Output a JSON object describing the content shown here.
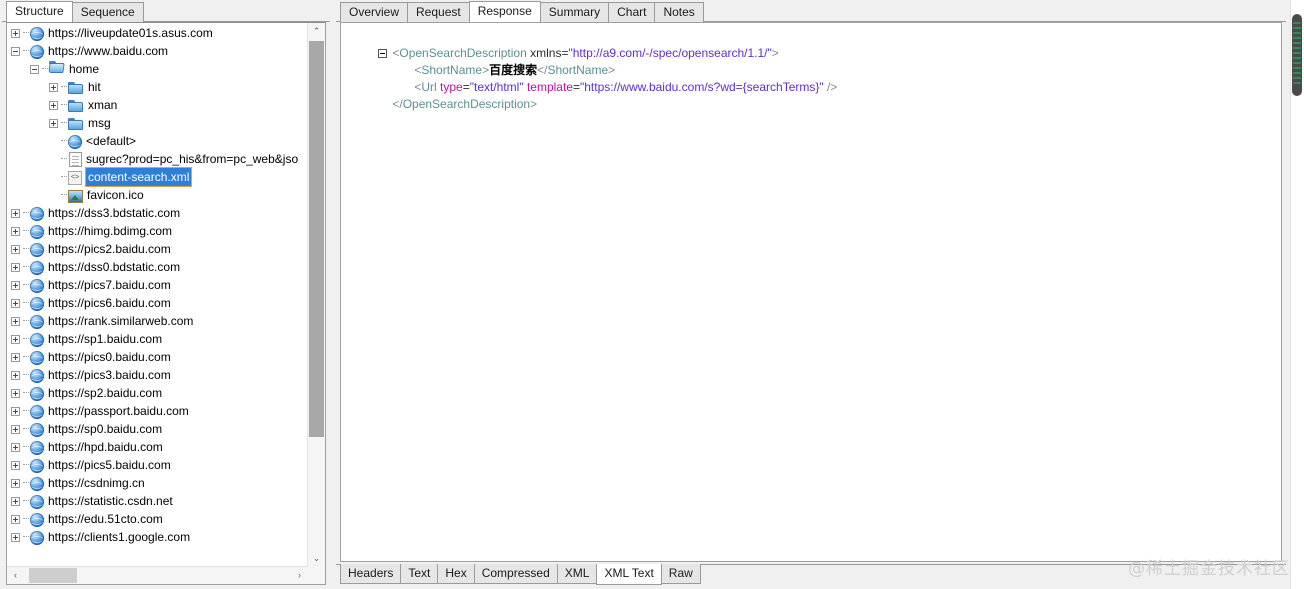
{
  "left_panel": {
    "tabs": [
      {
        "label": "Structure",
        "active": true
      },
      {
        "label": "Sequence",
        "active": false
      }
    ],
    "tree": [
      {
        "depth": 0,
        "expander": "plus",
        "icon": "globe-icon",
        "label": "https://liveupdate01s.asus.com",
        "selected": false
      },
      {
        "depth": 0,
        "expander": "minus",
        "icon": "globe-icon",
        "label": "https://www.baidu.com",
        "selected": false
      },
      {
        "depth": 1,
        "expander": "minus",
        "icon": "folder-open-icon",
        "label": "home",
        "selected": false
      },
      {
        "depth": 2,
        "expander": "plus",
        "icon": "folder-icon",
        "label": "hit",
        "selected": false
      },
      {
        "depth": 2,
        "expander": "plus",
        "icon": "folder-icon",
        "label": "xman",
        "selected": false
      },
      {
        "depth": 2,
        "expander": "plus",
        "icon": "folder-icon",
        "label": "msg",
        "selected": false
      },
      {
        "depth": 2,
        "expander": "none",
        "icon": "globe-icon",
        "label": "<default>",
        "selected": false
      },
      {
        "depth": 2,
        "expander": "none",
        "icon": "document-icon",
        "label": "sugrec?prod=pc_his&from=pc_web&jso",
        "selected": false
      },
      {
        "depth": 2,
        "expander": "none",
        "icon": "xml-file-icon",
        "label": "content-search.xml",
        "selected": true
      },
      {
        "depth": 2,
        "expander": "none",
        "icon": "image-file-icon",
        "label": "favicon.ico",
        "selected": false
      },
      {
        "depth": 0,
        "expander": "plus",
        "icon": "globe-icon",
        "label": "https://dss3.bdstatic.com",
        "selected": false
      },
      {
        "depth": 0,
        "expander": "plus",
        "icon": "globe-icon",
        "label": "https://himg.bdimg.com",
        "selected": false
      },
      {
        "depth": 0,
        "expander": "plus",
        "icon": "globe-icon",
        "label": "https://pics2.baidu.com",
        "selected": false
      },
      {
        "depth": 0,
        "expander": "plus",
        "icon": "globe-icon",
        "label": "https://dss0.bdstatic.com",
        "selected": false
      },
      {
        "depth": 0,
        "expander": "plus",
        "icon": "globe-icon",
        "label": "https://pics7.baidu.com",
        "selected": false
      },
      {
        "depth": 0,
        "expander": "plus",
        "icon": "globe-icon",
        "label": "https://pics6.baidu.com",
        "selected": false
      },
      {
        "depth": 0,
        "expander": "plus",
        "icon": "globe-icon",
        "label": "https://rank.similarweb.com",
        "selected": false
      },
      {
        "depth": 0,
        "expander": "plus",
        "icon": "globe-icon",
        "label": "https://sp1.baidu.com",
        "selected": false
      },
      {
        "depth": 0,
        "expander": "plus",
        "icon": "globe-icon",
        "label": "https://pics0.baidu.com",
        "selected": false
      },
      {
        "depth": 0,
        "expander": "plus",
        "icon": "globe-icon",
        "label": "https://pics3.baidu.com",
        "selected": false
      },
      {
        "depth": 0,
        "expander": "plus",
        "icon": "globe-icon",
        "label": "https://sp2.baidu.com",
        "selected": false
      },
      {
        "depth": 0,
        "expander": "plus",
        "icon": "globe-icon",
        "label": "https://passport.baidu.com",
        "selected": false
      },
      {
        "depth": 0,
        "expander": "plus",
        "icon": "globe-icon",
        "label": "https://sp0.baidu.com",
        "selected": false
      },
      {
        "depth": 0,
        "expander": "plus",
        "icon": "globe-icon",
        "label": "https://hpd.baidu.com",
        "selected": false
      },
      {
        "depth": 0,
        "expander": "plus",
        "icon": "globe-icon",
        "label": "https://pics5.baidu.com",
        "selected": false
      },
      {
        "depth": 0,
        "expander": "plus",
        "icon": "globe-icon",
        "label": "https://csdnimg.cn",
        "selected": false
      },
      {
        "depth": 0,
        "expander": "plus",
        "icon": "globe-icon",
        "label": "https://statistic.csdn.net",
        "selected": false
      },
      {
        "depth": 0,
        "expander": "plus",
        "icon": "globe-icon",
        "label": "https://edu.51cto.com",
        "selected": false
      },
      {
        "depth": 0,
        "expander": "plus",
        "icon": "globe-icon",
        "label": "https://clients1.google.com",
        "selected": false
      }
    ],
    "scrollbar": {
      "up_arrow": "⌃",
      "down_arrow": "⌄",
      "left_arrow": "‹",
      "right_arrow": "›"
    }
  },
  "right_panel": {
    "top_tabs": [
      {
        "label": "Overview",
        "active": false
      },
      {
        "label": "Request",
        "active": false
      },
      {
        "label": "Response",
        "active": true
      },
      {
        "label": "Summary",
        "active": false
      },
      {
        "label": "Chart",
        "active": false
      },
      {
        "label": "Notes",
        "active": false
      }
    ],
    "bottom_tabs": [
      {
        "label": "Headers",
        "active": false
      },
      {
        "label": "Text",
        "active": false
      },
      {
        "label": "Hex",
        "active": false
      },
      {
        "label": "Compressed",
        "active": false
      },
      {
        "label": "XML",
        "active": false
      },
      {
        "label": "XML Text",
        "active": true
      },
      {
        "label": "Raw",
        "active": false
      }
    ],
    "xml": {
      "line1": {
        "open_bracket": "<",
        "tag": "OpenSearchDescription",
        "space": " ",
        "attr_name": "xmlns",
        "equals": "=",
        "attr_value": "\"http://a9.com/-/spec/opensearch/1.1/\"",
        "close_bracket": ">"
      },
      "line2": {
        "open_bracket": "<",
        "tag": "ShortName",
        "close_bracket": ">",
        "text": "百度搜索",
        "end_open": "</",
        "end_tag": "ShortName",
        "end_close": ">"
      },
      "line3": {
        "open_bracket": "<",
        "tag": "Url",
        "space1": " ",
        "attr1_name": "type",
        "equals1": "=",
        "attr1_value": "\"text/html\"",
        "space2": " ",
        "attr2_name": "template",
        "equals2": "=",
        "attr2_value": "\"https://www.baidu.com/s?wd={searchTerms}\"",
        "close_bracket": " />"
      },
      "line4": {
        "end_open": "</",
        "tag": "OpenSearchDescription",
        "end_close": ">"
      }
    }
  },
  "watermark": {
    "text": "@稀土掘金技术社区"
  }
}
